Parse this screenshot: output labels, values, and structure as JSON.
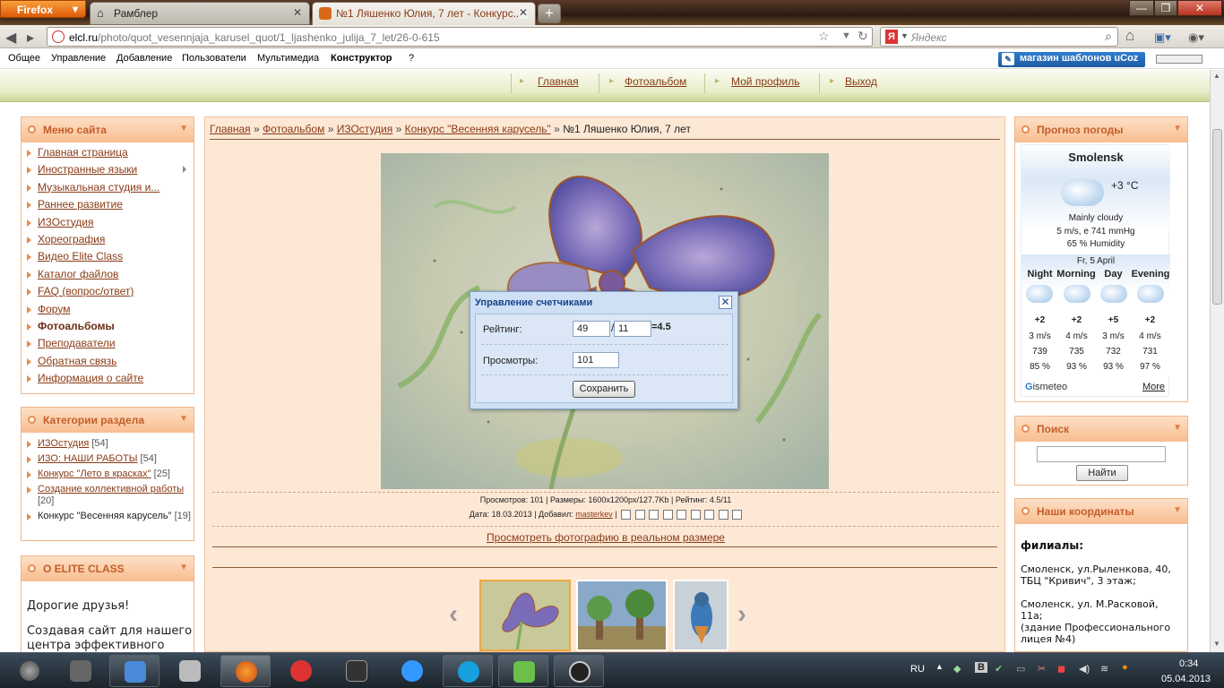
{
  "browser": {
    "menu_label": "Firefox",
    "tabs": [
      {
        "title": "Рамблер"
      },
      {
        "title": "№1 Ляшенко Юлия, 7 лет - Конкурс..."
      }
    ],
    "url_domain": "elcl.ru",
    "url_path": "/photo/quot_vesennjaja_karusel_quot/1_ljashenko_julija_7_let/26-0-615",
    "search_placeholder": "Яндекс",
    "search_logo": "Я",
    "win": {
      "min": "—",
      "max": "❐",
      "close": "✕"
    }
  },
  "admin": {
    "items": [
      "Общее",
      "Управление",
      "Добавление",
      "Пользователи",
      "Мультимедиа",
      "Конструктор",
      "?"
    ],
    "shop_label": "магазин шаблонов uCoz"
  },
  "header_nav": [
    "Главная",
    "Фотоальбом",
    "Мой профиль",
    "Выход"
  ],
  "site_menu": {
    "title": "Меню сайта",
    "items": [
      "Главная страница",
      "Иностранные языки",
      "Музыкальная студия и...",
      "Раннее развитие",
      "ИЗОстудия",
      "Хореография",
      "Видео Elite Class",
      "Каталог файлов",
      "FAQ (вопрос/ответ)",
      "Форум",
      "Фотоальбомы",
      "Преподаватели",
      "Обратная связь",
      "Информация о сайте"
    ]
  },
  "categories": {
    "title": "Категории раздела",
    "items": [
      {
        "name": "ИЗОстудия",
        "count": "[54]"
      },
      {
        "name": "ИЗО: НАШИ РАБОТЫ",
        "count": "[54]"
      },
      {
        "name": "Конкурс \"Лето в красках\"",
        "count": "[25]"
      },
      {
        "name": "Создание коллективной работы",
        "count": "[20]"
      },
      {
        "name": "Конкурс \"Весенняя карусель\"",
        "count": "[19]"
      }
    ]
  },
  "about": {
    "title": "О ELITE CLASS",
    "line1": "Дорогие друзья!",
    "line2": "Создавая сайт для нашего",
    "line3": "центра эффективного"
  },
  "breadcrumbs": {
    "links": [
      "Главная",
      "Фотоальбом",
      "ИЗОстудия",
      "Конкурс \"Весенняя карусель\""
    ],
    "sep": "»",
    "current": "№1 Ляшенко Юлия, 7 лет"
  },
  "photo_meta": {
    "line1": "Просмотров: 101 | Размеры: 1600x1200px/127.7Kb | Рейтинг: 4.5/11",
    "date_label": "Дата: 18.03.2013 | Добавил:",
    "author": "masterkev",
    "real_size_link": "Просмотреть фотографию в реальном размере"
  },
  "modal": {
    "title": "Управление счетчиками",
    "close": "✕",
    "rating_label": "Рейтинг:",
    "rating_sum": "49",
    "slash": "/",
    "rating_votes": "11",
    "rating_result": "=4.5",
    "views_label": "Просмотры:",
    "views_value": "101",
    "save_label": "Сохранить"
  },
  "weather": {
    "title": "Прогноз погоды",
    "city": "Smolensk",
    "temp": "+3 °C",
    "desc": "Mainly cloudy",
    "wind_pressure": "5 m/s, e  741 mmHg",
    "humidity": "65 % Humidity",
    "date": "Fr, 5 April",
    "periods": [
      {
        "name": "Night",
        "temp": "+2",
        "wind": "3 m/s",
        "press": "739",
        "hum": "85 %"
      },
      {
        "name": "Morning",
        "temp": "+2",
        "wind": "4 m/s",
        "press": "735",
        "hum": "93 %"
      },
      {
        "name": "Day",
        "temp": "+5",
        "wind": "3 m/s",
        "press": "732",
        "hum": "93 %"
      },
      {
        "name": "Evening",
        "temp": "+2",
        "wind": "4 m/s",
        "press": "731",
        "hum": "97 %"
      }
    ],
    "brand_g": "G",
    "brand_rest": "ismeteo",
    "more": "More"
  },
  "search_block": {
    "title": "Поиск",
    "button": "Найти"
  },
  "coords": {
    "title": "Наши координаты",
    "heading": "филиалы:",
    "addr1a": "Смоленск, ул.Рыленкова, 40,",
    "addr1b": "ТБЦ \"Кривич\", 3 этаж;",
    "addr2a": "Смоленск, ул. М.Расковой,",
    "addr2b": "11а;",
    "addr2c": "(здание Профессионального",
    "addr2d": "лицея №4)"
  },
  "taskbar": {
    "lang": "RU",
    "time": "0:34",
    "date": "05.04.2013"
  }
}
